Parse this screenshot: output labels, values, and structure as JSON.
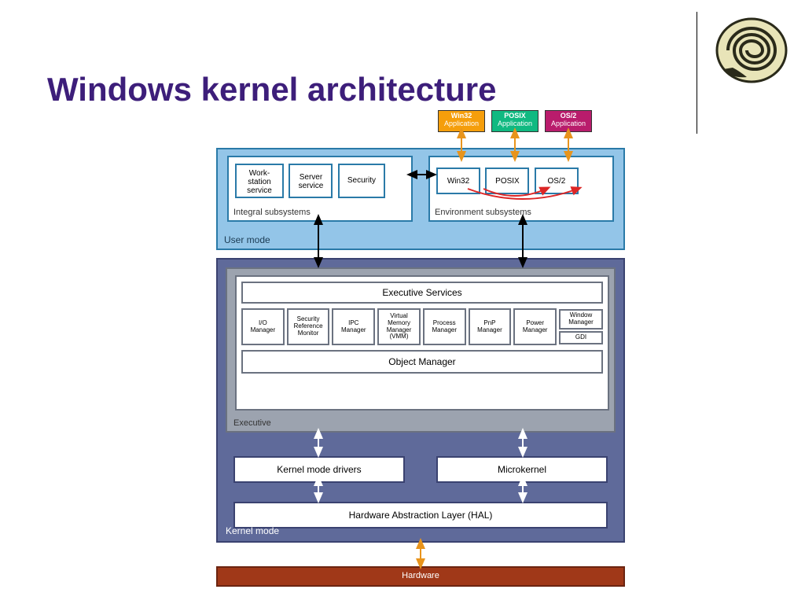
{
  "title": "Windows kernel architecture",
  "apps": [
    {
      "name": "Win32",
      "sub": "Application"
    },
    {
      "name": "POSIX",
      "sub": "Application"
    },
    {
      "name": "OS/2",
      "sub": "Application"
    }
  ],
  "user_mode": {
    "label": "User mode",
    "integral": {
      "label": "Integral subsystems",
      "items": [
        "Work-\nstation\nservice",
        "Server\nservice",
        "Security"
      ]
    },
    "environment": {
      "label": "Environment subsystems",
      "items": [
        "Win32",
        "POSIX",
        "OS/2"
      ]
    }
  },
  "kernel_mode": {
    "label": "Kernel mode",
    "executive": {
      "label": "Executive",
      "services": "Executive Services",
      "managers": [
        "I/O\nManager",
        "Security\nReference\nMonitor",
        "IPC\nManager",
        "Virtual\nMemory\nManager\n(VMM)",
        "Process\nManager",
        "PnP\nManager",
        "Power\nManager"
      ],
      "window_col": [
        "Window\nManager",
        "GDI"
      ],
      "object_manager": "Object Manager"
    },
    "drivers": "Kernel mode drivers",
    "microkernel": "Microkernel",
    "hal": "Hardware Abstraction Layer (HAL)"
  },
  "hardware": "Hardware"
}
